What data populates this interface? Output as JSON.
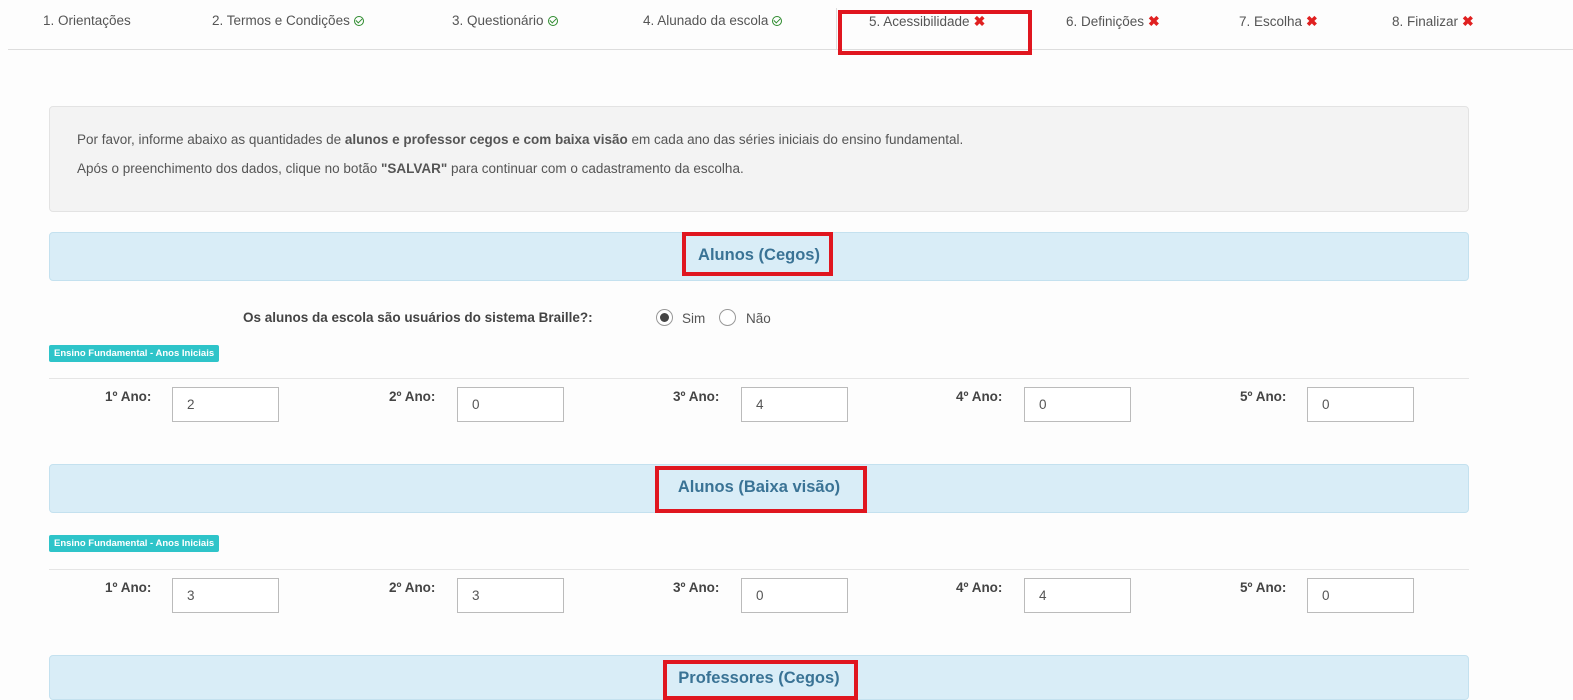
{
  "tabs": [
    {
      "label": "1. Orientações",
      "status": ""
    },
    {
      "label": "2. Termos e Condições",
      "status": "ok"
    },
    {
      "label": "3. Questionário",
      "status": "ok"
    },
    {
      "label": "4. Alunado da escola",
      "status": "ok"
    },
    {
      "label": "5. Acessibilidade",
      "status": "x"
    },
    {
      "label": "6. Definições",
      "status": "x"
    },
    {
      "label": "7. Escolha",
      "status": "x"
    },
    {
      "label": "8. Finalizar",
      "status": "x"
    }
  ],
  "info": {
    "line1_pre": "Por favor, informe abaixo as quantidades de ",
    "line1_bold": "alunos e professor cegos e com baixa visão",
    "line1_post": " em cada ano das séries iniciais do ensino fundamental.",
    "line2_pre": "Após o preenchimento dos dados, clique no botão ",
    "line2_bold": "\"SALVAR\"",
    "line2_post": " para continuar com o cadastramento da escolha."
  },
  "sections": {
    "cegos": {
      "title": "Alunos (Cegos)",
      "question": "Os alunos da escola são usuários do sistema Braille?:",
      "option_yes": "Sim",
      "option_no": "Não",
      "selected": "Sim",
      "badge": "Ensino Fundamental - Anos Iniciais",
      "fields": [
        {
          "label": "1º Ano:",
          "value": "2"
        },
        {
          "label": "2º Ano:",
          "value": "0"
        },
        {
          "label": "3º Ano:",
          "value": "4"
        },
        {
          "label": "4º Ano:",
          "value": "0"
        },
        {
          "label": "5º Ano:",
          "value": "0"
        }
      ]
    },
    "baixa_visao": {
      "title": "Alunos (Baixa visão)",
      "badge": "Ensino Fundamental - Anos Iniciais",
      "fields": [
        {
          "label": "1º Ano:",
          "value": "3"
        },
        {
          "label": "2º Ano:",
          "value": "3"
        },
        {
          "label": "3º Ano:",
          "value": "0"
        },
        {
          "label": "4º Ano:",
          "value": "4"
        },
        {
          "label": "5º Ano:",
          "value": "0"
        }
      ]
    },
    "professores": {
      "title": "Professores (Cegos)"
    }
  }
}
